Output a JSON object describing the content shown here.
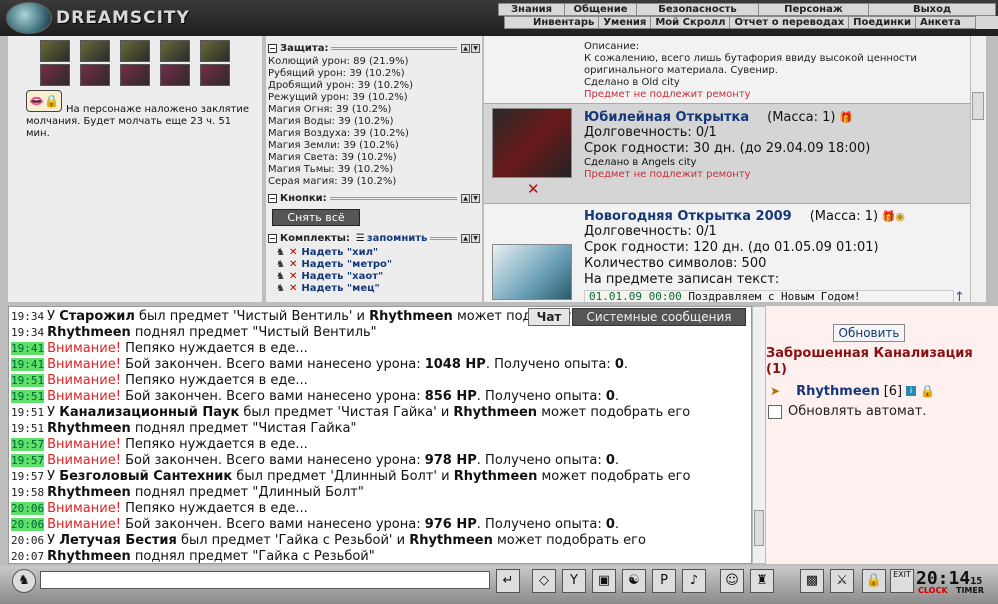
{
  "header": {
    "logo": "DREAMSCITY",
    "top_menu": [
      "Знания",
      "Общение",
      "Безопасность",
      "Персонаж",
      "Выход"
    ],
    "sub_menu": [
      "Инвентарь",
      "Умения",
      "Мой Скролл",
      "Отчет о переводах",
      "Поединки",
      "Анкета"
    ]
  },
  "status": {
    "silence_text": "На персонаже наложено заклятие молчания. Будет молчать еще 23 ч. 51 мин."
  },
  "stats": {
    "protection_title": "Защита:",
    "protection": [
      "Колющий урон: 89 (21.9%)",
      "Рубящий урон: 39 (10.2%)",
      "Дробящий урон: 39 (10.2%)",
      "Режущий урон: 39 (10.2%)",
      "Магия Огня: 39 (10.2%)",
      "Магия Воды: 39 (10.2%)",
      "Магия Воздуха: 39 (10.2%)",
      "Магия Земли: 39 (10.2%)",
      "Магия Света: 39 (10.2%)",
      "Магия Тьмы: 39 (10.2%)",
      "Серая магия: 39 (10.2%)"
    ],
    "buttons_title": "Кнопки:",
    "remove_all": "Снять всё",
    "kits_title": "Комплекты:",
    "remember": "запомнить",
    "kits": [
      "Надеть \"хил\"",
      "Надеть \"метро\"",
      "Надеть \"хаот\"",
      "Надеть \"мец\""
    ]
  },
  "items": {
    "first": {
      "desc_label": "Описание:",
      "desc": "К сожалению, всего лишь бутафория ввиду высокой ценности оригинального материала. Сувенир.",
      "made": "Сделано в Old city",
      "repair": "Предмет не подлежит ремонту"
    },
    "second": {
      "name": "Юбилейная Открытка",
      "mass": "(Масса: 1)",
      "durability": "Долговечность: 0/1",
      "expiry": "Срок годности: 30 дн. (до 29.04.09 18:00)",
      "made": "Сделано в Angels city",
      "repair": "Предмет не подлежит ремонту"
    },
    "third": {
      "name": "Новогодняя Открытка 2009",
      "mass": "(Масса: 1)",
      "durability": "Долговечность: 0/1",
      "expiry": "Срок годности: 120 дн. (до 01.05.09 01:01)",
      "chars": "Количество символов: 500",
      "written": "На предмете записан текст:",
      "inscription_time": "01.01.09 00:00",
      "inscription": "Поздравляем с Новым Годом!"
    }
  },
  "chat": {
    "tab_chat": "Чат",
    "tab_system": "Системные сообщения",
    "lines": [
      {
        "t": "19:34",
        "hl": false,
        "parts": [
          [
            "У ",
            ""
          ],
          [
            "Старожил",
            "b"
          ],
          [
            " был предмет 'Чистый Вентиль' и ",
            ""
          ],
          [
            "Rhythmeen",
            "b"
          ],
          [
            " может подобрать его",
            ""
          ]
        ]
      },
      {
        "t": "19:34",
        "hl": false,
        "parts": [
          [
            "Rhythmeen",
            "b"
          ],
          [
            " поднял предмет \"Чистый Вентиль\"",
            ""
          ]
        ]
      },
      {
        "t": "19:41",
        "hl": true,
        "parts": [
          [
            "Внимание!",
            "warn"
          ],
          [
            " Пепяко нуждается в еде...",
            ""
          ]
        ]
      },
      {
        "t": "19:41",
        "hl": true,
        "parts": [
          [
            "Внимание!",
            "warn"
          ],
          [
            " Бой закончен. Всего вами нанесено урона: ",
            ""
          ],
          [
            "1048 HP",
            "b"
          ],
          [
            ". Получено опыта: ",
            ""
          ],
          [
            "0",
            "b"
          ],
          [
            ".",
            ""
          ]
        ]
      },
      {
        "t": "19:51",
        "hl": true,
        "parts": [
          [
            "Внимание!",
            "warn"
          ],
          [
            " Пепяко нуждается в еде...",
            ""
          ]
        ]
      },
      {
        "t": "19:51",
        "hl": true,
        "parts": [
          [
            "Внимание!",
            "warn"
          ],
          [
            " Бой закончен. Всего вами нанесено урона: ",
            ""
          ],
          [
            "856 HP",
            "b"
          ],
          [
            ". Получено опыта: ",
            ""
          ],
          [
            "0",
            "b"
          ],
          [
            ".",
            ""
          ]
        ]
      },
      {
        "t": "19:51",
        "hl": false,
        "parts": [
          [
            "У ",
            ""
          ],
          [
            "Канализационный Паук",
            "b"
          ],
          [
            " был предмет 'Чистая Гайка' и ",
            ""
          ],
          [
            "Rhythmeen",
            "b"
          ],
          [
            " может подобрать его",
            ""
          ]
        ]
      },
      {
        "t": "19:51",
        "hl": false,
        "parts": [
          [
            "Rhythmeen",
            "b"
          ],
          [
            " поднял предмет \"Чистая Гайка\"",
            ""
          ]
        ]
      },
      {
        "t": "19:57",
        "hl": true,
        "parts": [
          [
            "Внимание!",
            "warn"
          ],
          [
            " Пепяко нуждается в еде...",
            ""
          ]
        ]
      },
      {
        "t": "19:57",
        "hl": true,
        "parts": [
          [
            "Внимание!",
            "warn"
          ],
          [
            " Бой закончен. Всего вами нанесено урона: ",
            ""
          ],
          [
            "978 HP",
            "b"
          ],
          [
            ". Получено опыта: ",
            ""
          ],
          [
            "0",
            "b"
          ],
          [
            ".",
            ""
          ]
        ]
      },
      {
        "t": "19:57",
        "hl": false,
        "parts": [
          [
            "У ",
            ""
          ],
          [
            "Безголовый Сантехник",
            "b"
          ],
          [
            " был предмет 'Длинный Болт' и ",
            ""
          ],
          [
            "Rhythmeen",
            "b"
          ],
          [
            " может подобрать его",
            ""
          ]
        ]
      },
      {
        "t": "19:58",
        "hl": false,
        "parts": [
          [
            "Rhythmeen",
            "b"
          ],
          [
            " поднял предмет \"Длинный Болт\"",
            ""
          ]
        ]
      },
      {
        "t": "20:06",
        "hl": true,
        "parts": [
          [
            "Внимание!",
            "warn"
          ],
          [
            " Пепяко нуждается в еде...",
            ""
          ]
        ]
      },
      {
        "t": "20:06",
        "hl": true,
        "parts": [
          [
            "Внимание!",
            "warn"
          ],
          [
            " Бой закончен. Всего вами нанесено урона: ",
            ""
          ],
          [
            "976 HP",
            "b"
          ],
          [
            ". Получено опыта: ",
            ""
          ],
          [
            "0",
            "b"
          ],
          [
            ".",
            ""
          ]
        ]
      },
      {
        "t": "20:06",
        "hl": false,
        "parts": [
          [
            "У ",
            ""
          ],
          [
            "Летучая Бестия",
            "b"
          ],
          [
            " был предмет 'Гайка с Резьбой' и ",
            ""
          ],
          [
            "Rhythmeen",
            "b"
          ],
          [
            " может подобрать его",
            ""
          ]
        ]
      },
      {
        "t": "20:07",
        "hl": false,
        "parts": [
          [
            "Rhythmeen",
            "b"
          ],
          [
            " поднял предмет \"Гайка с Резьбой\"",
            ""
          ]
        ]
      }
    ]
  },
  "room": {
    "refresh": "Обновить",
    "location": "Заброшенная Канализация (1)",
    "player": "Rhythmeen",
    "level": "[6]",
    "auto_update": "Обновлять автомат."
  },
  "toolbar": {
    "clock": "20:14",
    "seconds": "15",
    "clock_label": "CLOCK",
    "timer_label": "TIMER",
    "exit_label": "EXIT"
  }
}
